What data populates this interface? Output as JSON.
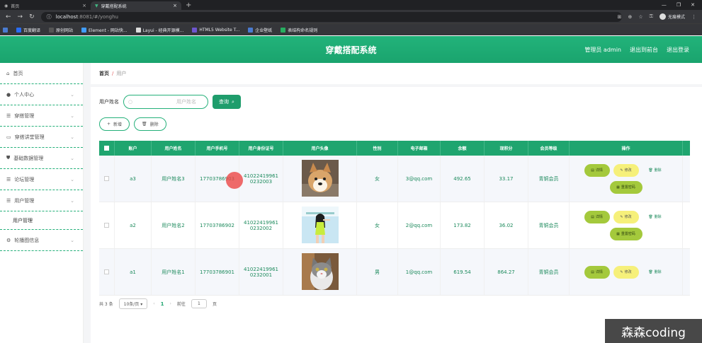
{
  "browser": {
    "tabs": [
      {
        "label": "首页",
        "active": false
      },
      {
        "label": "穿戴搭配系统",
        "active": true
      }
    ],
    "url": "localhost:8081/#/yonghu",
    "url_host": "localhost",
    "url_path": ":8081/#/yonghu",
    "guest_label": "无痕模式",
    "bookmarks": [
      {
        "label": "百度翻译",
        "color": "#2a6df4"
      },
      {
        "label": "原创网站",
        "color": "#555"
      },
      {
        "label": "Element - 网站快...",
        "color": "#409eff"
      },
      {
        "label": "Layui - 经典开源模...",
        "color": "#ddd"
      },
      {
        "label": "HTML5 Website T...",
        "color": "#6e56cf"
      },
      {
        "label": "企业壁纸",
        "color": "#4a7bd0"
      },
      {
        "label": "表结构命名规则",
        "color": "#27ae60"
      }
    ]
  },
  "header": {
    "title": "穿戴搭配系统",
    "admin": "管理员 admin",
    "backend": "退出到前台",
    "logout": "退出登录"
  },
  "sidebar": {
    "items": [
      {
        "label": "首页",
        "icon": "home-icon",
        "expandable": false
      },
      {
        "label": "个人中心",
        "icon": "user-icon",
        "expandable": true
      },
      {
        "label": "穿搭管理",
        "icon": "list-icon",
        "expandable": true
      },
      {
        "label": "穿搭讲堂管理",
        "icon": "monitor-icon",
        "expandable": true
      },
      {
        "label": "基础数据管理",
        "icon": "shield-icon",
        "expandable": true
      },
      {
        "label": "论坛管理",
        "icon": "list-icon",
        "expandable": true
      },
      {
        "label": "用户管理",
        "icon": "list-icon",
        "expandable": true
      }
    ],
    "subitem": "用户管理",
    "last_item": {
      "label": "轮播图信息",
      "icon": "settings-icon"
    }
  },
  "breadcrumb": {
    "home": "首页",
    "sep": "/",
    "current": "用户"
  },
  "search": {
    "label": "用户姓名",
    "placeholder": "用户姓名",
    "button": "查询"
  },
  "toolbar": {
    "add": "新增",
    "delete": "删除"
  },
  "table": {
    "headers": [
      "账户",
      "用户姓名",
      "用户手机号",
      "用户身份证号",
      "用户头像",
      "性别",
      "电子邮箱",
      "余额",
      "现积分",
      "会员等级",
      "操作"
    ],
    "rows": [
      {
        "account": "a3",
        "name": "用户姓名3",
        "phone": "17703786903",
        "id1": "41022419961",
        "id2": "0232003",
        "avatar": "dog",
        "gender": "女",
        "email": "3@qq.com",
        "balance": "492.65",
        "points": "33.17",
        "level": "青铜会员",
        "reset": "重置密码"
      },
      {
        "account": "a2",
        "name": "用户姓名2",
        "phone": "17703786902",
        "id1": "41022419961",
        "id2": "0232002",
        "avatar": "girl",
        "gender": "女",
        "email": "2@qq.com",
        "balance": "173.82",
        "points": "36.02",
        "level": "青铜会员",
        "reset": "重置密码"
      },
      {
        "account": "a1",
        "name": "用户姓名1",
        "phone": "17703786901",
        "id1": "41022419961",
        "id2": "0232001",
        "avatar": "cat",
        "gender": "男",
        "email": "1@qq.com",
        "balance": "619.54",
        "points": "864.27",
        "level": "青铜会员",
        "reset": ""
      }
    ],
    "actions": {
      "detail": "详情",
      "edit": "修改",
      "delete": "删除"
    }
  },
  "pager": {
    "total": "共 3 条",
    "size": "10条/页",
    "page": "1",
    "goto": "前往",
    "goto_value": "1",
    "unit": "页"
  },
  "watermark": "森森coding"
}
